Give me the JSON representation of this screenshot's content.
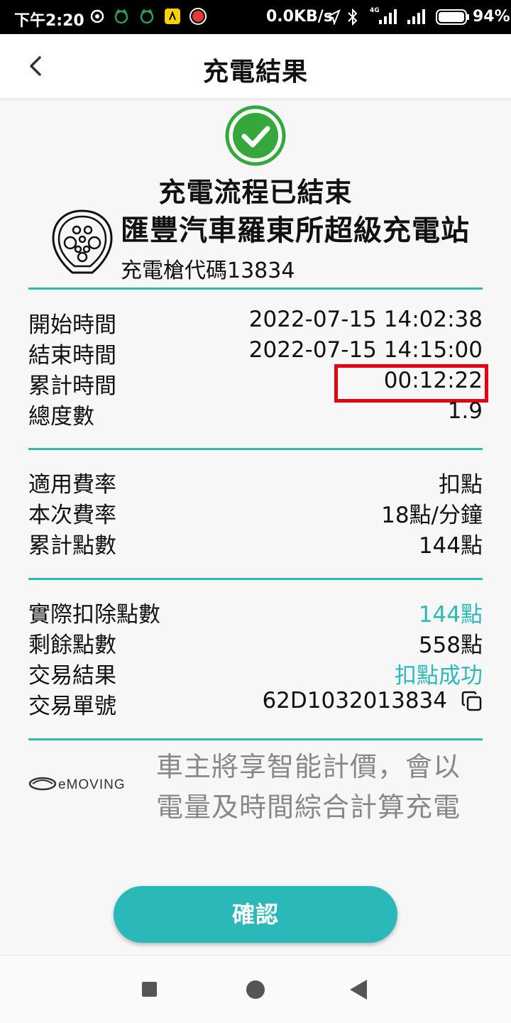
{
  "status_bar": {
    "time": "下午2:20",
    "network_speed": "0.0KB/s",
    "signal_label": "4G",
    "battery": "94%"
  },
  "header": {
    "title": "充電結果",
    "back_icon": "chevron-left-icon"
  },
  "result": {
    "status_text": "充電流程已結束",
    "station_name": "匯豐汽車羅東所超級充電站",
    "gun_code_label": "充電槍代碼",
    "gun_code": "13834",
    "success_color": "#36a83b"
  },
  "session": [
    {
      "label": "開始時間",
      "value": "2022-07-15 14:02:38"
    },
    {
      "label": "結束時間",
      "value": "2022-07-15 14:15:00"
    },
    {
      "label": "累計時間",
      "value": "00:12:22"
    },
    {
      "label": "總度數",
      "value": "1.9"
    }
  ],
  "rate": [
    {
      "label": "適用費率",
      "value": "扣點"
    },
    {
      "label": "本次費率",
      "value": "18點/分鐘"
    },
    {
      "label": "累計點數",
      "value": "144點"
    }
  ],
  "payment": [
    {
      "label": "實際扣除點數",
      "value": "144點"
    },
    {
      "label": "剩餘點數",
      "value": "558點"
    },
    {
      "label": "交易結果",
      "value": "扣點成功"
    },
    {
      "label": "交易單號",
      "value": "62D1032013834"
    }
  ],
  "footer": {
    "logo_text": "eMOVING",
    "notice": "車主將享智能計價，會以電量及時間綜合計算充電",
    "confirm_label": "確認"
  },
  "colors": {
    "accent": "#2cb9b8",
    "highlight": "#e60012"
  }
}
